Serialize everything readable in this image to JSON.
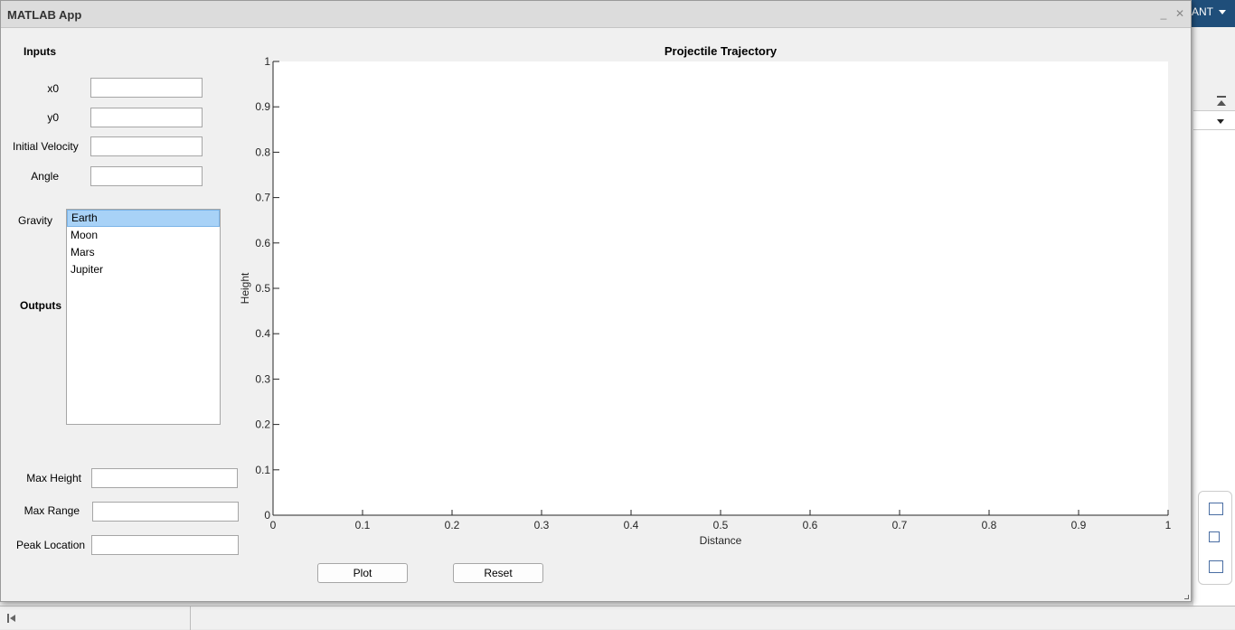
{
  "window": {
    "title": "MATLAB App"
  },
  "background": {
    "menu_label": "ANT"
  },
  "inputs": {
    "heading": "Inputs",
    "x0_label": "x0",
    "x0_value": "",
    "y0_label": "y0",
    "y0_value": "",
    "velocity_label": "Initial Velocity",
    "velocity_value": "",
    "angle_label": "Angle",
    "angle_value": ""
  },
  "gravity": {
    "label": "Gravity",
    "options": [
      "Earth",
      "Moon",
      "Mars",
      "Jupiter"
    ],
    "selected": "Earth"
  },
  "outputs": {
    "heading": "Outputs",
    "max_height_label": "Max Height",
    "max_height_value": "",
    "max_range_label": "Max Range",
    "max_range_value": "",
    "peak_location_label": "Peak Location",
    "peak_location_value": ""
  },
  "buttons": {
    "plot": "Plot",
    "reset": "Reset"
  },
  "chart_data": {
    "type": "line",
    "title": "Projectile Trajectory",
    "xlabel": "Distance",
    "ylabel": "Height",
    "xlim": [
      0,
      1
    ],
    "ylim": [
      0,
      1
    ],
    "xticks": [
      "0",
      "0.1",
      "0.2",
      "0.3",
      "0.4",
      "0.5",
      "0.6",
      "0.7",
      "0.8",
      "0.9",
      "1"
    ],
    "yticks": [
      "0",
      "0.1",
      "0.2",
      "0.3",
      "0.4",
      "0.5",
      "0.6",
      "0.7",
      "0.8",
      "0.9",
      "1"
    ],
    "series": [],
    "grid": false
  }
}
